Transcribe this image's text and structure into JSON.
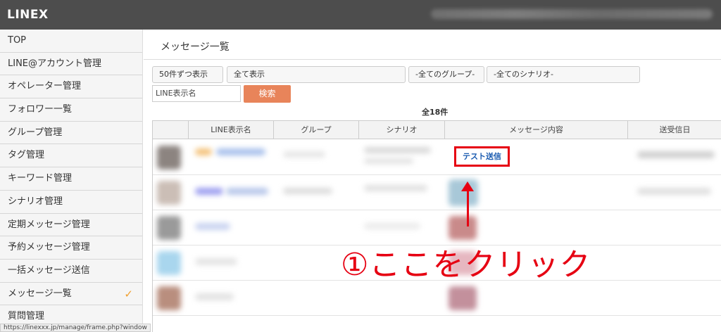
{
  "app": {
    "title": "LINEX"
  },
  "sidebar": {
    "items": [
      {
        "label": "TOP",
        "active": false
      },
      {
        "label": "LINE@アカウント管理",
        "active": false
      },
      {
        "label": "オペレーター管理",
        "active": false
      },
      {
        "label": "フォロワー一覧",
        "active": false
      },
      {
        "label": "グループ管理",
        "active": false
      },
      {
        "label": "タグ管理",
        "active": false
      },
      {
        "label": "キーワード管理",
        "active": false
      },
      {
        "label": "シナリオ管理",
        "active": false
      },
      {
        "label": "定期メッセージ管理",
        "active": false
      },
      {
        "label": "予約メッセージ管理",
        "active": false
      },
      {
        "label": "一括メッセージ送信",
        "active": false
      },
      {
        "label": "メッセージ一覧",
        "active": true,
        "mark": "✓"
      },
      {
        "label": "質問管理",
        "active": false
      }
    ]
  },
  "status_url": "https://linexxx.jp/manage/frame.php?window",
  "main": {
    "title": "メッセージ一覧",
    "filters": {
      "per_page_label": "50件ずつ表示",
      "show_all_label": "全て表示",
      "group_select": "-全てのグループ-",
      "scenario_select": "-全てのシナリオ-",
      "name_placeholder": "LINE表示名",
      "search_label": "検索"
    },
    "total": "全18件",
    "table": {
      "columns": [
        "",
        "LINE表示名",
        "グループ",
        "シナリオ",
        "メッセージ内容",
        "送受信日"
      ],
      "first_row_message": "テスト送信"
    }
  },
  "annotation": {
    "arrow": "↑",
    "text": "①ここをクリック",
    "color": "#e60012"
  },
  "colors": {
    "accent": "#e8845a",
    "highlight": "#e60012",
    "topbar": "#4d4d4d",
    "link": "#1a5bb0"
  }
}
